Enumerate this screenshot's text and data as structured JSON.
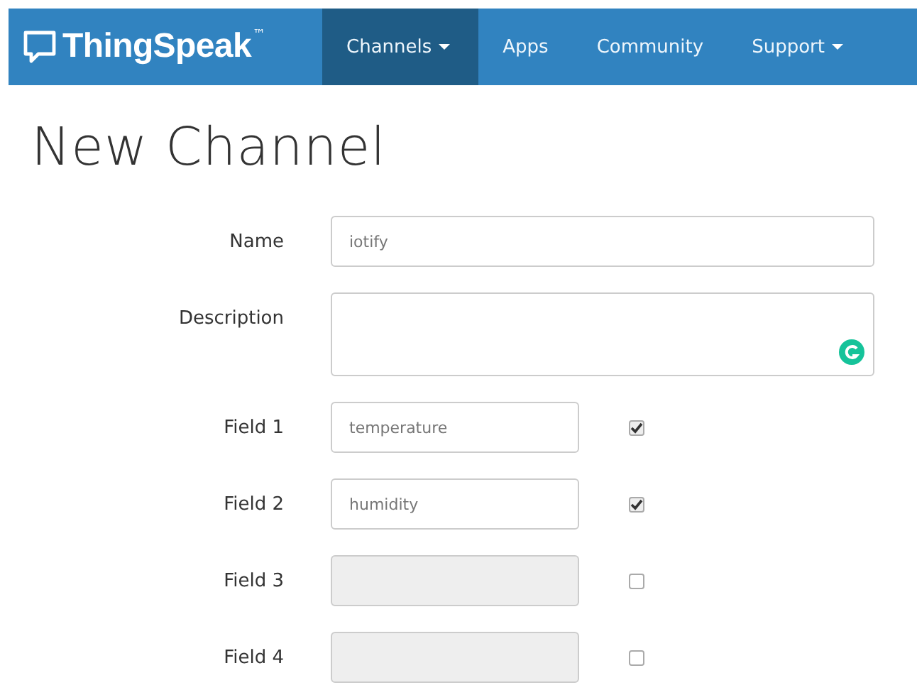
{
  "navbar": {
    "brand": "ThingSpeak",
    "trademark": "™",
    "items": [
      {
        "label": "Channels",
        "dropdown": true,
        "selected": true
      },
      {
        "label": "Apps",
        "dropdown": false,
        "selected": false
      },
      {
        "label": "Community",
        "dropdown": false,
        "selected": false
      },
      {
        "label": "Support",
        "dropdown": true,
        "selected": false
      }
    ]
  },
  "page_title": "New Channel",
  "form": {
    "rows": [
      {
        "kind": "text",
        "label": "Name",
        "value": "iotify"
      },
      {
        "kind": "textarea",
        "label": "Description"
      },
      {
        "kind": "field",
        "label": "Field 1",
        "value": "temperature",
        "disabled": false,
        "checked": true
      },
      {
        "kind": "field",
        "label": "Field 2",
        "value": "humidity",
        "disabled": false,
        "checked": true
      },
      {
        "kind": "field",
        "label": "Field 3",
        "disabled": true,
        "checked": false
      },
      {
        "kind": "field",
        "label": "Field 4",
        "disabled": true,
        "checked": false
      }
    ]
  }
}
